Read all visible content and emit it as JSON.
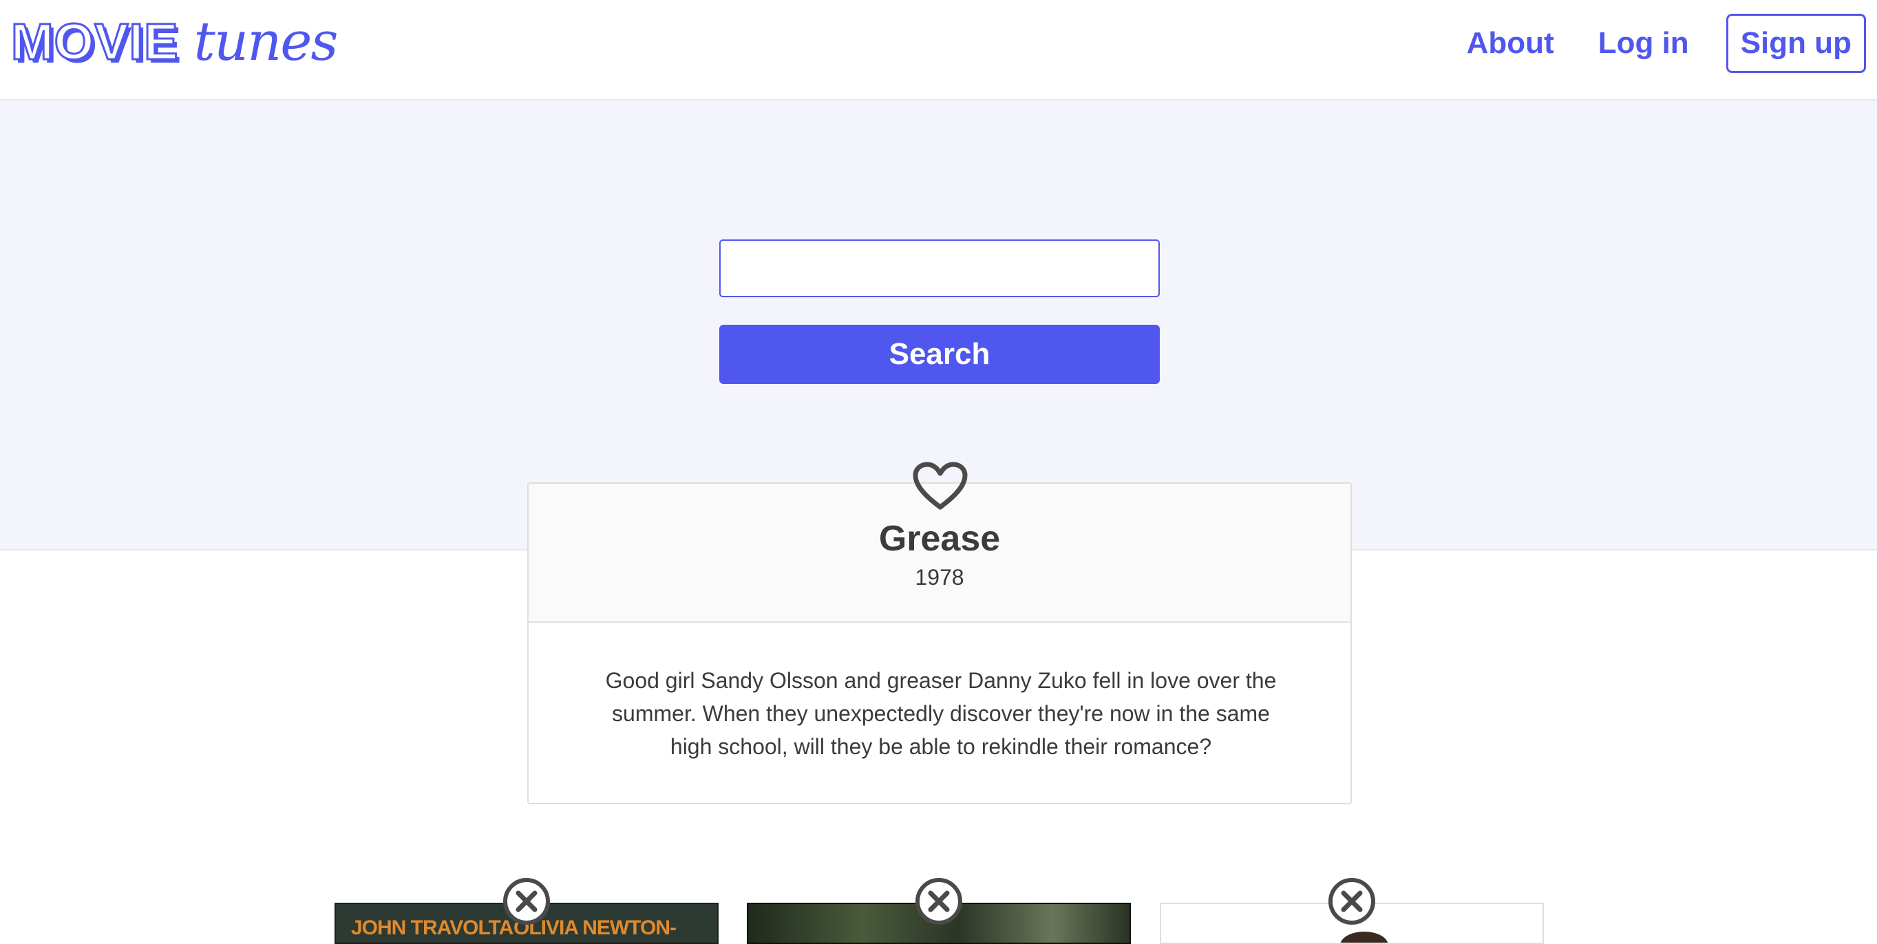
{
  "brand": {
    "logo_movie": "MOVIE",
    "logo_tunes": "tunes",
    "accent_color": "#5057ee"
  },
  "nav": {
    "about": "About",
    "login": "Log in",
    "signup": "Sign up"
  },
  "search": {
    "placeholder": "",
    "value": "",
    "button_label": "Search"
  },
  "movie": {
    "title": "Grease",
    "year": "1978",
    "description": "Good girl Sandy Olsson and greaser Danny Zuko fell in love over the summer. When they unexpectedly discover they're now in the same high school, will they be able to rekindle their romance?",
    "favorite_icon": "heart-outline-icon"
  },
  "results": [
    {
      "poster_text_left": "JOHN TRAVOLTA",
      "poster_text_right": "OLIVIA NEWTON-JOHN",
      "remove_icon": "close-circle-icon"
    },
    {
      "remove_icon": "close-circle-icon"
    },
    {
      "remove_icon": "close-circle-icon"
    }
  ]
}
